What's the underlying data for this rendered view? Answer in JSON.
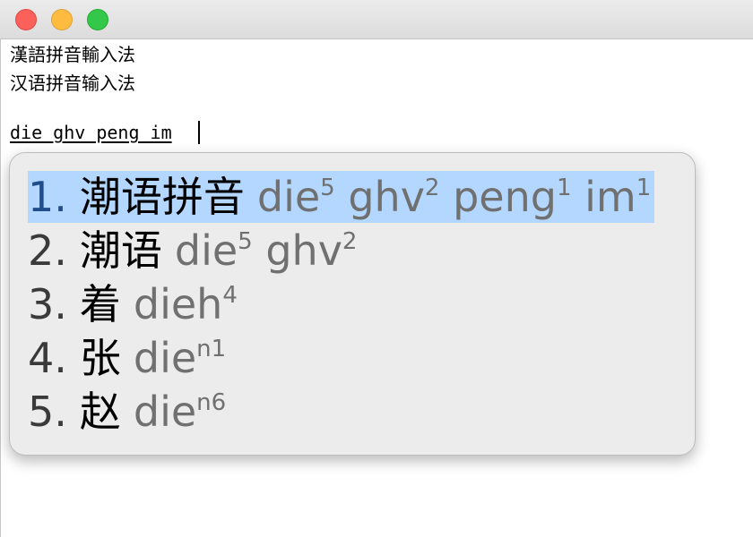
{
  "document": {
    "line1": "漢語拼音輸入法",
    "line2": "汉语拼音输入法",
    "composition": "die ghv peng im"
  },
  "candidates": [
    {
      "index": "1.",
      "text": "潮语拼音",
      "selected": true,
      "romanization": [
        {
          "syl": "die",
          "tone": "5"
        },
        {
          "syl": "ghv",
          "tone": "2"
        },
        {
          "syl": "peng",
          "tone": "1"
        },
        {
          "syl": "im",
          "tone": "1"
        }
      ]
    },
    {
      "index": "2.",
      "text": "潮语",
      "selected": false,
      "romanization": [
        {
          "syl": "die",
          "tone": "5"
        },
        {
          "syl": "ghv",
          "tone": "2"
        }
      ]
    },
    {
      "index": "3.",
      "text": "着",
      "selected": false,
      "romanization": [
        {
          "syl": "dieh",
          "tone": "4"
        }
      ]
    },
    {
      "index": "4.",
      "text": "张",
      "selected": false,
      "romanization": [
        {
          "syl": "die",
          "tone": "n1"
        }
      ]
    },
    {
      "index": "5.",
      "text": "赵",
      "selected": false,
      "romanization": [
        {
          "syl": "die",
          "tone": "n6"
        }
      ]
    }
  ],
  "colors": {
    "selection": "#b3d7ff",
    "panel_background": "#ececec",
    "romanization": "#707070",
    "close": "#fc605b",
    "minimize": "#fdbc40",
    "maximize": "#34c84a"
  }
}
